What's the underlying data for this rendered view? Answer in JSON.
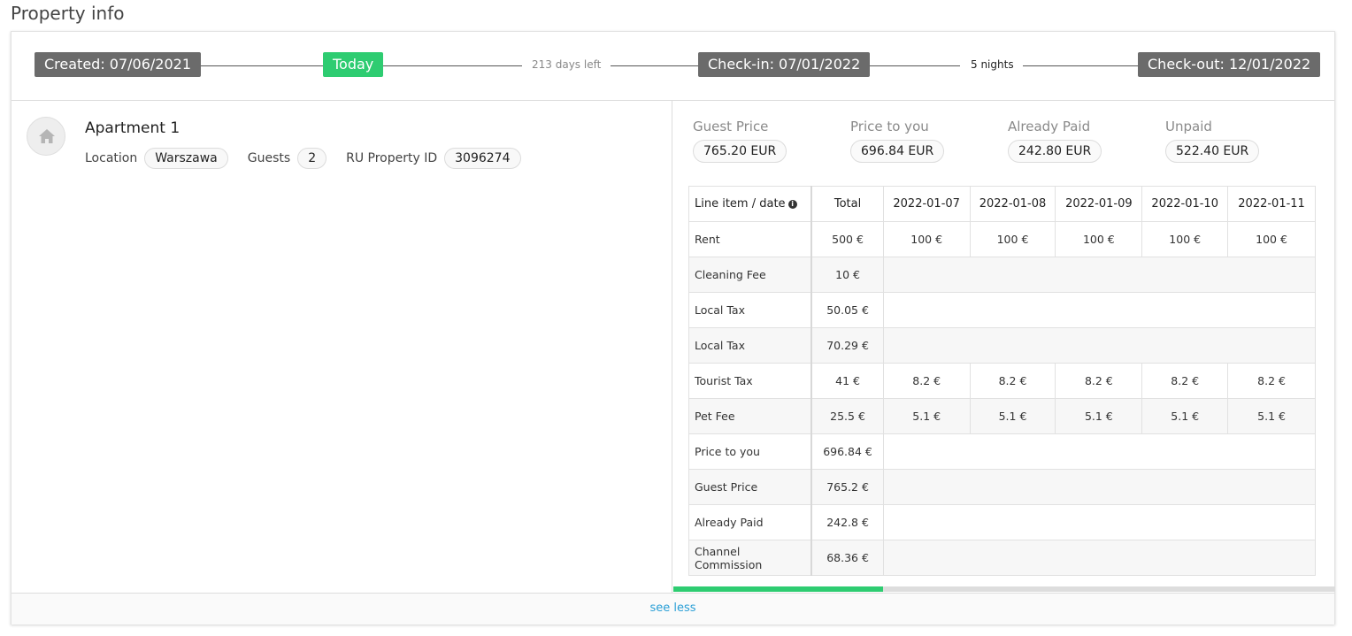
{
  "page": {
    "title": "Property info"
  },
  "timeline": {
    "created": "Created: 07/06/2021",
    "today": "Today",
    "days_left": "213 days left",
    "checkin": "Check-in: 07/01/2022",
    "nights": "5 nights",
    "checkout": "Check-out: 12/01/2022"
  },
  "property": {
    "name": "Apartment 1",
    "icon": "home-icon",
    "location_label": "Location",
    "location": "Warszawa",
    "guests_label": "Guests",
    "guests": "2",
    "ru_id_label": "RU Property ID",
    "ru_id": "3096274"
  },
  "summary": [
    {
      "label": "Guest Price",
      "value": "765.20 EUR"
    },
    {
      "label": "Price to you",
      "value": "696.84 EUR"
    },
    {
      "label": "Already Paid",
      "value": "242.80 EUR"
    },
    {
      "label": "Unpaid",
      "value": "522.40 EUR"
    }
  ],
  "table": {
    "headers": [
      "Line item / date",
      "Total",
      "2022-01-07",
      "2022-01-08",
      "2022-01-09",
      "2022-01-10",
      "2022-01-11"
    ],
    "rows": [
      {
        "item": "Rent",
        "total": "500 €",
        "days": [
          "100 €",
          "100 €",
          "100 €",
          "100 €",
          "100 €"
        ]
      },
      {
        "item": "Cleaning Fee",
        "total": "10 €",
        "days": []
      },
      {
        "item": "Local Tax",
        "total": "50.05 €",
        "days": []
      },
      {
        "item": "Local Tax",
        "total": "70.29 €",
        "days": []
      },
      {
        "item": "Tourist Tax",
        "total": "41 €",
        "days": [
          "8.2 €",
          "8.2 €",
          "8.2 €",
          "8.2 €",
          "8.2 €"
        ]
      },
      {
        "item": "Pet Fee",
        "total": "25.5 €",
        "days": [
          "5.1 €",
          "5.1 €",
          "5.1 €",
          "5.1 €",
          "5.1 €"
        ]
      },
      {
        "item": "Price to you",
        "total": "696.84 €",
        "days": []
      },
      {
        "item": "Guest Price",
        "total": "765.2 €",
        "days": []
      },
      {
        "item": "Already Paid",
        "total": "242.8 €",
        "days": []
      },
      {
        "item": "Channel Commission",
        "total": "68.36 €",
        "days": []
      }
    ]
  },
  "scrollbar": {
    "position_fraction": 0.32
  },
  "footer": {
    "see_less": "see less"
  },
  "colors": {
    "accent_green": "#2ecc71",
    "tag_dark": "#6b6b6b",
    "link_blue": "#2a9fd6"
  }
}
